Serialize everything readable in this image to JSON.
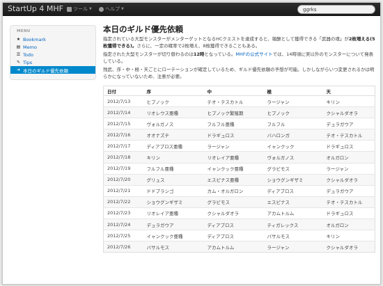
{
  "navbar": {
    "brand": "StartUp 4 MHF",
    "menu_tools": "ツール",
    "menu_help": "ヘルプ",
    "search_value": "ggrks"
  },
  "sidebar": {
    "header": "MENU",
    "items": [
      {
        "label": "Bookmark",
        "icon": "star-icon"
      },
      {
        "label": "Memo",
        "icon": "document-icon"
      },
      {
        "label": "Todo",
        "icon": "list-icon"
      },
      {
        "label": "Tips",
        "icon": "pencil-icon"
      },
      {
        "label": "本日のギルド優先依頼",
        "icon": "arrow-icon",
        "active": true
      }
    ]
  },
  "main": {
    "title": "本日のギルド優先依頼",
    "p1_a": "指定されている大型モンスターがメンターゲットとなるHCクエストを達成すると、報酬として獲得できる「武器の魂」が",
    "p1_b": "2枚増える(5枚獲得できる)。",
    "p1_c": "さらに、一定の確率で2枚増え、8枚獲得できることもある。",
    "p2_a": "指定された大型モンスターが切り替わるのは",
    "p2_b": "12時",
    "p2_c": "となっている。",
    "p2_link": "MHFの公式サイト",
    "p2_d": "では、14時頃に実以外のモンスターについて発表している。",
    "p3": "残武、序・中・極・天ごとにローテーションが確定しているため、ギルド優先依頼の予想が可能。しかしながらいつ変更されるかは明らかになっていないため、注意が必要。"
  },
  "table": {
    "headers": [
      "日付",
      "序",
      "中",
      "極",
      "天"
    ],
    "rows": [
      [
        "2012/7/13",
        "ヒプノック",
        "テオ・テスカトル",
        "ラージャン",
        "キリン"
      ],
      [
        "2012/7/14",
        "リオレウス亜種",
        "ヒプノック繁殖期",
        "ヒプノック",
        "クシャルダオラ"
      ],
      [
        "2012/7/15",
        "ヴォルガノス",
        "フルフル亜種",
        "フルフル",
        "デュラガウア"
      ],
      [
        "2012/7/16",
        "オオナズチ",
        "ドラギュロス",
        "バハロンガ",
        "テオ・テスカトル"
      ],
      [
        "2012/7/17",
        "ディアブロス亜種",
        "ラージャン",
        "イャンクック",
        "ドラギュロス"
      ],
      [
        "2012/7/18",
        "キリン",
        "リオレイア亜種",
        "ヴォルガノス",
        "オルガロン"
      ],
      [
        "2012/7/19",
        "フルフル亜種",
        "イャンクック亜種",
        "グラビモス",
        "ラージャン"
      ],
      [
        "2012/7/20",
        "グリュス",
        "エスピナス亜種",
        "ショウグンギザミ",
        "クシャルダオラ"
      ],
      [
        "2012/7/21",
        "ドドブランゴ",
        "カム・オルガロン",
        "ディアブロス",
        "デュラガウア"
      ],
      [
        "2012/7/22",
        "ショウグンギザミ",
        "グラビモス",
        "エスピナス",
        "テオ・テスカトル"
      ],
      [
        "2012/7/23",
        "リオレイア亜種",
        "クシャルダオラ",
        "アカムトルム",
        "ドラギュロス"
      ],
      [
        "2012/7/24",
        "デュラガウア",
        "ディアブロス",
        "ティガレックス",
        "オルガロン"
      ],
      [
        "2012/7/25",
        "イャンクック亜種",
        "ディアブロス",
        "バサルモス",
        "キリン"
      ],
      [
        "2012/7/26",
        "バサルモス",
        "アカムトルム",
        "ラージャン",
        "クシャルダオラ"
      ]
    ]
  },
  "colors": {
    "navbar": "#1b1b1b",
    "accent": "#0088cc",
    "link": "#0063bf"
  }
}
